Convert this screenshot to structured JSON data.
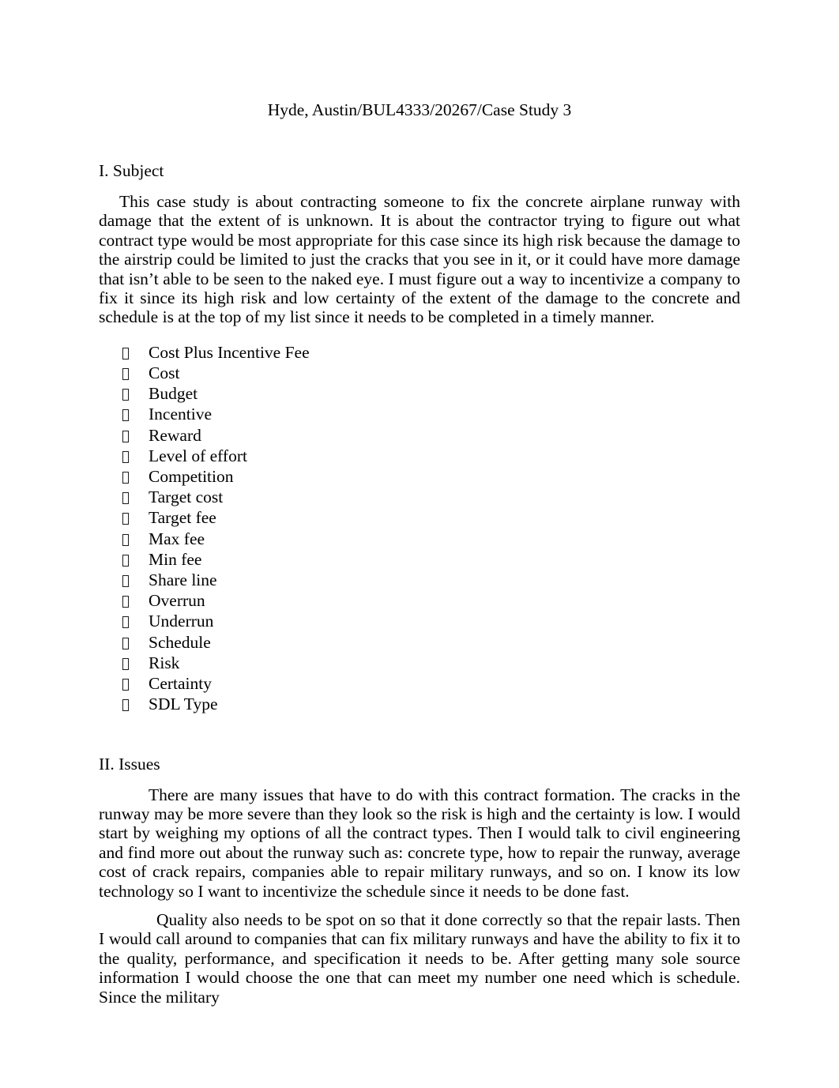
{
  "document": {
    "title": "Hyde, Austin/BUL4333/20267/Case Study 3",
    "page_background": "#ffffff",
    "text_color": "#000000",
    "sections": {
      "subject": {
        "heading": "I. Subject",
        "paragraph": "This case study is about contracting someone to fix the concrete airplane runway with damage that the extent of is unknown. It is about the contractor trying to figure out what contract type would be most appropriate for this case since its high risk because the damage to the airstrip could be limited to just the cracks that you see in it, or it could have more damage that isn’t able to be seen to the naked eye. I must figure out a way to incentivize a company to fix it since its high risk and low certainty of the extent of the damage to the concrete and schedule is at the top of my list since it needs to be completed in a timely manner.",
        "bullet_marker_glyph": "tofu-box",
        "bullets": [
          "Cost Plus Incentive Fee",
          "Cost",
          "Budget",
          "Incentive",
          "Reward",
          "Level of effort",
          "Competition",
          "Target cost",
          "Target fee",
          "Max fee",
          "Min fee",
          "Share line",
          "Overrun",
          "Underrun",
          "Schedule",
          "Risk",
          "Certainty",
          "SDL Type"
        ]
      },
      "issues": {
        "heading": "II. Issues",
        "paragraph_1": "There are many issues that have to do with this contract formation. The cracks in the runway may be more severe than they look so the risk is high and the certainty is low. I would start by weighing my options of all the contract types. Then I would talk to civil engineering and find more out about the runway such as: concrete type, how to repair the runway, average cost of crack repairs, companies able to repair military runways, and so on. I know its low technology so I want to incentivize the schedule since it needs to be done fast.",
        "paragraph_2": "Quality also needs to be spot on so that it done correctly so that the repair lasts. Then I would call around to companies that can fix military runways and have the ability to fix it to the quality, performance, and specification it needs to be. After getting many sole source information I would choose the one that can meet my number one need which is schedule. Since the military"
      }
    }
  }
}
